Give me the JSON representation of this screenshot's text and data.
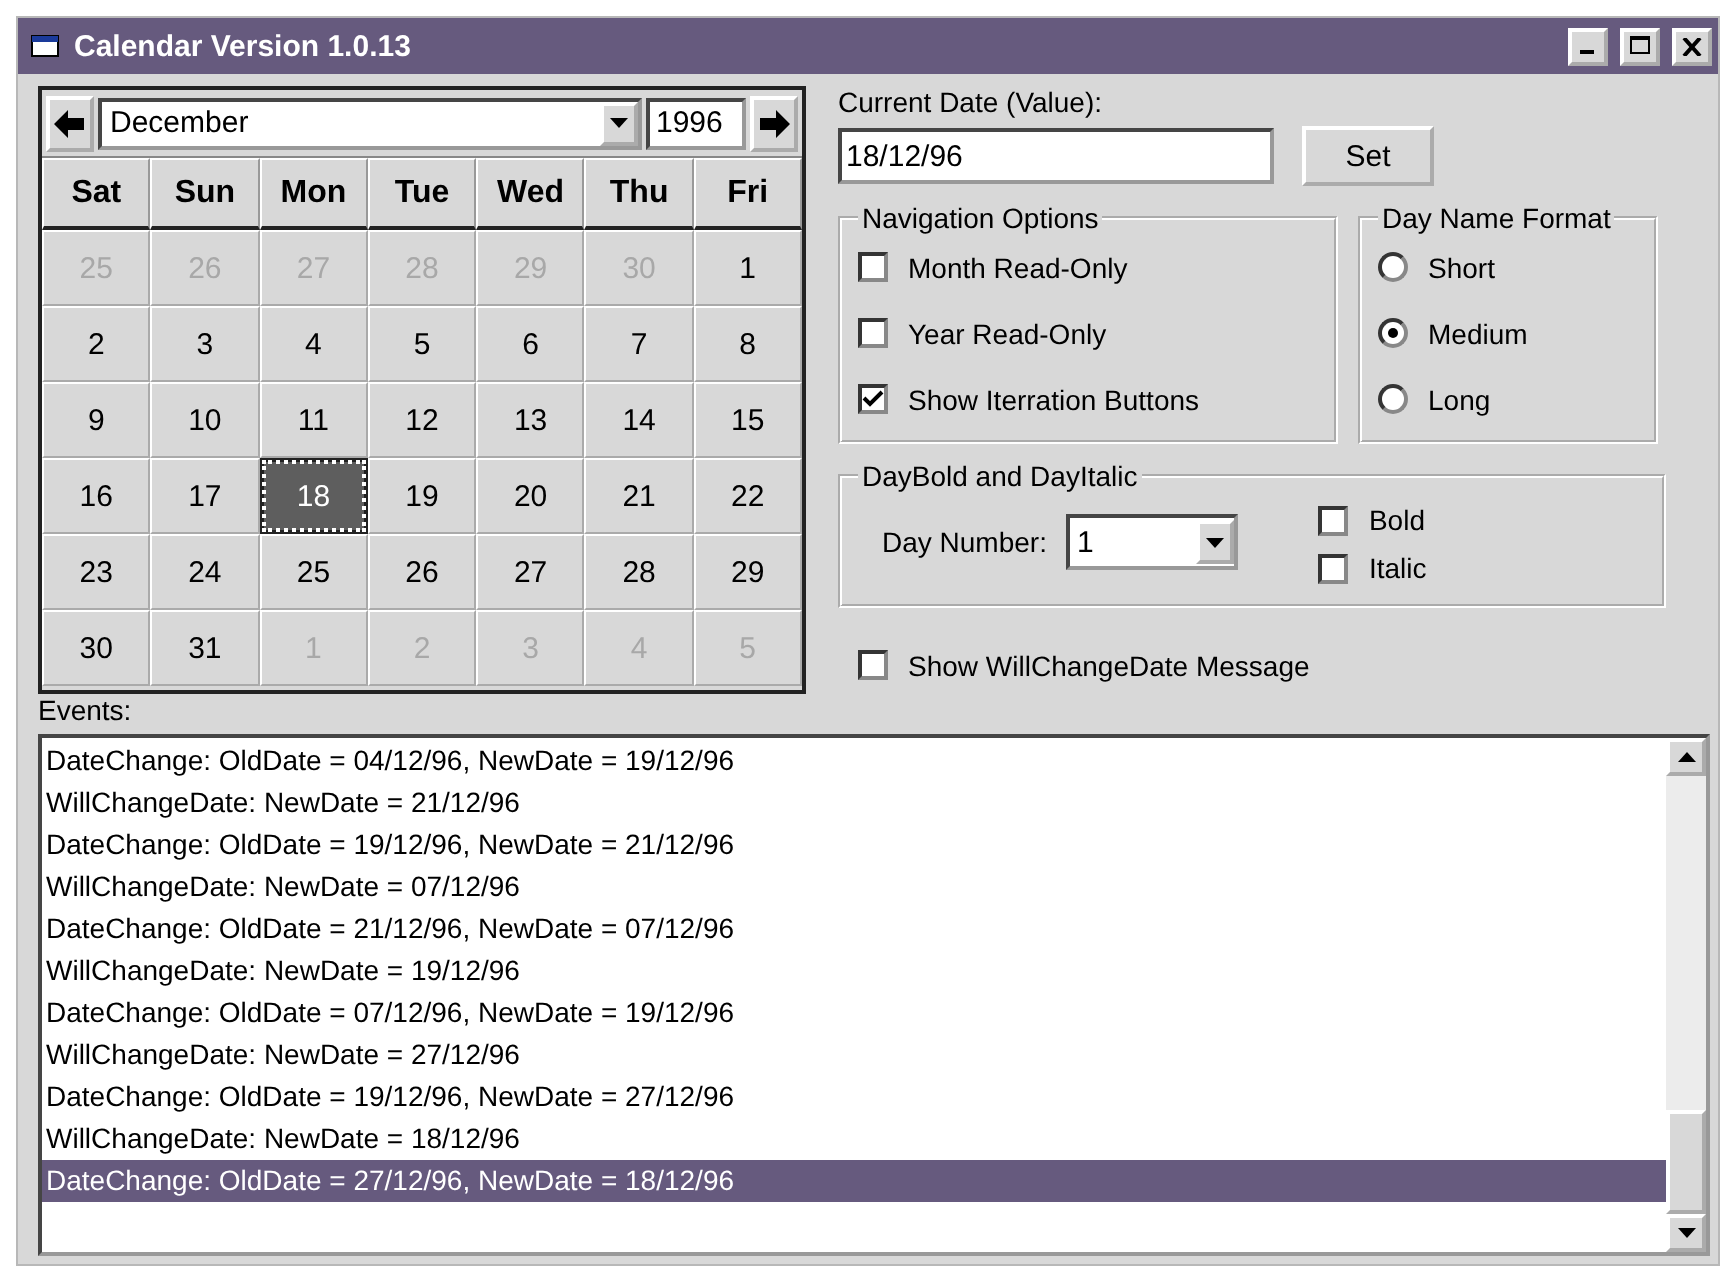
{
  "window": {
    "title": "Calendar Version 1.0.13"
  },
  "calendar": {
    "month": "December",
    "year": "1996",
    "day_names": [
      "Sat",
      "Sun",
      "Mon",
      "Tue",
      "Wed",
      "Thu",
      "Fri"
    ],
    "weeks": [
      [
        {
          "day": "25",
          "other_month": true,
          "selected": false
        },
        {
          "day": "26",
          "other_month": true,
          "selected": false
        },
        {
          "day": "27",
          "other_month": true,
          "selected": false
        },
        {
          "day": "28",
          "other_month": true,
          "selected": false
        },
        {
          "day": "29",
          "other_month": true,
          "selected": false
        },
        {
          "day": "30",
          "other_month": true,
          "selected": false
        },
        {
          "day": "1",
          "other_month": false,
          "selected": false
        }
      ],
      [
        {
          "day": "2",
          "other_month": false,
          "selected": false
        },
        {
          "day": "3",
          "other_month": false,
          "selected": false
        },
        {
          "day": "4",
          "other_month": false,
          "selected": false
        },
        {
          "day": "5",
          "other_month": false,
          "selected": false
        },
        {
          "day": "6",
          "other_month": false,
          "selected": false
        },
        {
          "day": "7",
          "other_month": false,
          "selected": false
        },
        {
          "day": "8",
          "other_month": false,
          "selected": false
        }
      ],
      [
        {
          "day": "9",
          "other_month": false,
          "selected": false
        },
        {
          "day": "10",
          "other_month": false,
          "selected": false
        },
        {
          "day": "11",
          "other_month": false,
          "selected": false
        },
        {
          "day": "12",
          "other_month": false,
          "selected": false
        },
        {
          "day": "13",
          "other_month": false,
          "selected": false
        },
        {
          "day": "14",
          "other_month": false,
          "selected": false
        },
        {
          "day": "15",
          "other_month": false,
          "selected": false
        }
      ],
      [
        {
          "day": "16",
          "other_month": false,
          "selected": false
        },
        {
          "day": "17",
          "other_month": false,
          "selected": false
        },
        {
          "day": "18",
          "other_month": false,
          "selected": true
        },
        {
          "day": "19",
          "other_month": false,
          "selected": false
        },
        {
          "day": "20",
          "other_month": false,
          "selected": false
        },
        {
          "day": "21",
          "other_month": false,
          "selected": false
        },
        {
          "day": "22",
          "other_month": false,
          "selected": false
        }
      ],
      [
        {
          "day": "23",
          "other_month": false,
          "selected": false
        },
        {
          "day": "24",
          "other_month": false,
          "selected": false
        },
        {
          "day": "25",
          "other_month": false,
          "selected": false
        },
        {
          "day": "26",
          "other_month": false,
          "selected": false
        },
        {
          "day": "27",
          "other_month": false,
          "selected": false
        },
        {
          "day": "28",
          "other_month": false,
          "selected": false
        },
        {
          "day": "29",
          "other_month": false,
          "selected": false
        }
      ],
      [
        {
          "day": "30",
          "other_month": false,
          "selected": false
        },
        {
          "day": "31",
          "other_month": false,
          "selected": false
        },
        {
          "day": "1",
          "other_month": true,
          "selected": false
        },
        {
          "day": "2",
          "other_month": true,
          "selected": false
        },
        {
          "day": "3",
          "other_month": true,
          "selected": false
        },
        {
          "day": "4",
          "other_month": true,
          "selected": false
        },
        {
          "day": "5",
          "other_month": true,
          "selected": false
        }
      ]
    ]
  },
  "current_date": {
    "label": "Current Date (Value):",
    "value": "18/12/96",
    "button": "Set"
  },
  "navigation_options": {
    "title": "Navigation Options",
    "items": [
      {
        "label": "Month Read-Only",
        "checked": false
      },
      {
        "label": "Year Read-Only",
        "checked": false
      },
      {
        "label": "Show Iterration Buttons",
        "checked": true
      }
    ]
  },
  "day_name_format": {
    "title": "Day Name Format",
    "options": [
      {
        "label": "Short",
        "selected": false
      },
      {
        "label": "Medium",
        "selected": true
      },
      {
        "label": "Long",
        "selected": false
      }
    ]
  },
  "day_bold_italic": {
    "title": "DayBold and DayItalic",
    "day_number_label": "Day Number:",
    "day_number": "1",
    "options": [
      {
        "label": "Bold",
        "checked": false
      },
      {
        "label": "Italic",
        "checked": false
      }
    ]
  },
  "show_message": {
    "label": "Show WillChangeDate Message",
    "checked": false
  },
  "events": {
    "label": "Events:",
    "items": [
      {
        "text": "DateChange: OldDate = 04/12/96, NewDate = 19/12/96",
        "selected": false
      },
      {
        "text": "WillChangeDate: NewDate = 21/12/96",
        "selected": false
      },
      {
        "text": "DateChange: OldDate = 19/12/96, NewDate = 21/12/96",
        "selected": false
      },
      {
        "text": "WillChangeDate: NewDate = 07/12/96",
        "selected": false
      },
      {
        "text": "DateChange: OldDate = 21/12/96, NewDate = 07/12/96",
        "selected": false
      },
      {
        "text": "WillChangeDate: NewDate = 19/12/96",
        "selected": false
      },
      {
        "text": "DateChange: OldDate = 07/12/96, NewDate = 19/12/96",
        "selected": false
      },
      {
        "text": "WillChangeDate: NewDate = 27/12/96",
        "selected": false
      },
      {
        "text": "DateChange: OldDate = 19/12/96, NewDate = 27/12/96",
        "selected": false
      },
      {
        "text": "WillChangeDate: NewDate = 18/12/96",
        "selected": false
      },
      {
        "text": "DateChange: OldDate = 27/12/96, NewDate = 18/12/96",
        "selected": true
      }
    ]
  }
}
